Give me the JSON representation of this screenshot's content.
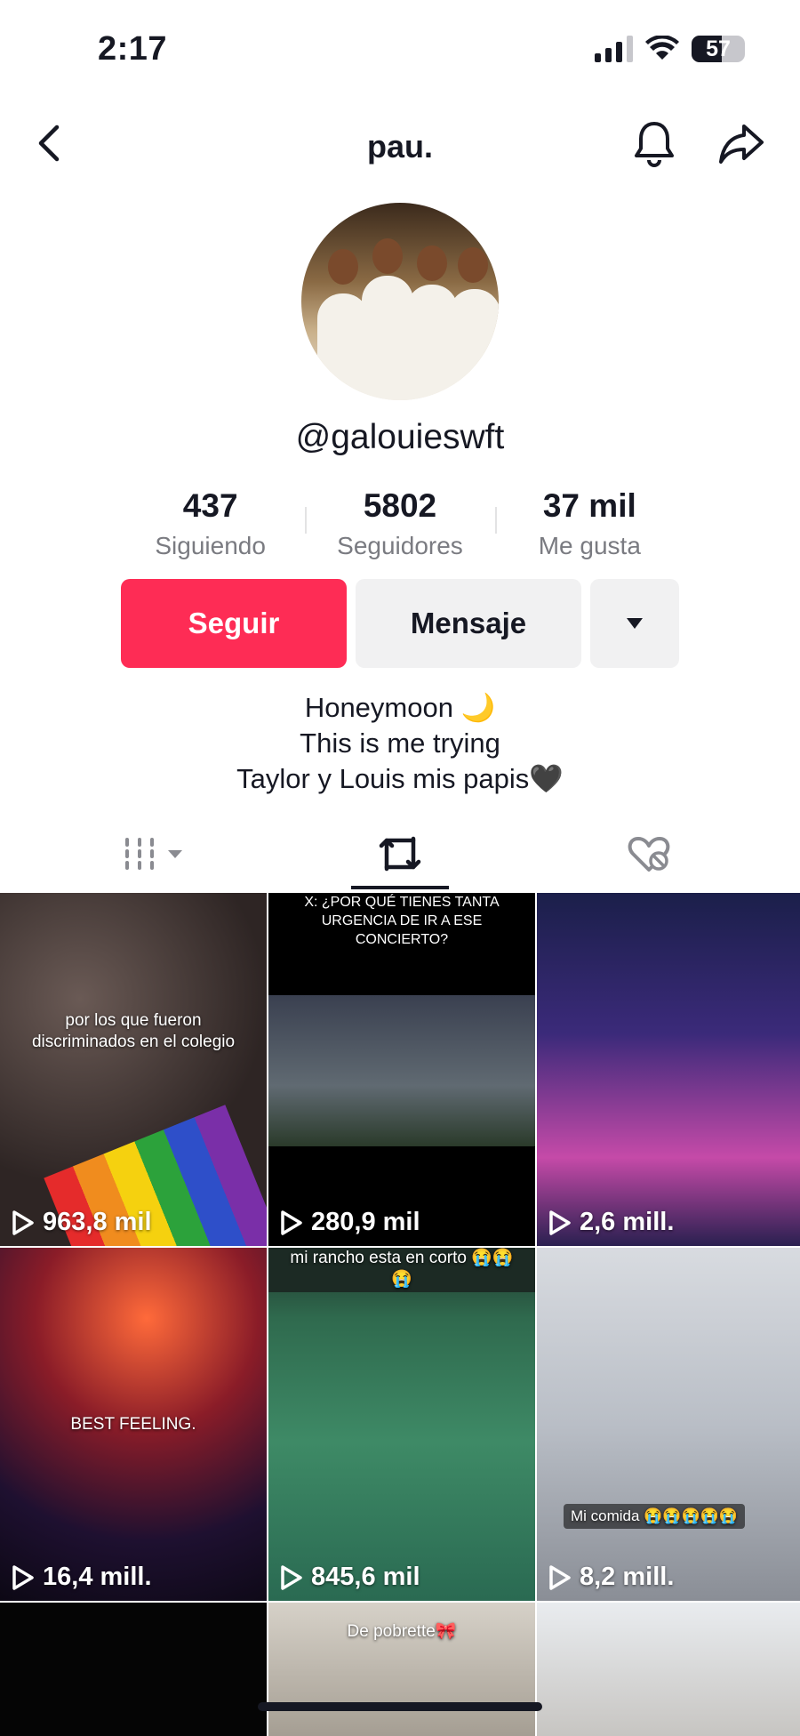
{
  "status_bar": {
    "time": "2:17",
    "battery": "57"
  },
  "nav": {
    "title": "pau."
  },
  "profile": {
    "handle": "@galouieswft"
  },
  "stats": [
    {
      "value": "437",
      "label": "Siguiendo"
    },
    {
      "value": "5802",
      "label": "Seguidores"
    },
    {
      "value": "37 mil",
      "label": "Me gusta"
    }
  ],
  "actions": {
    "follow": "Seguir",
    "message": "Mensaje"
  },
  "bio": {
    "line1": "Honeymoon 🌙",
    "line2": "This is me trying",
    "line3": "Taylor y Louis mis papis🖤"
  },
  "icons": {
    "back": "chevron-left-icon",
    "notifications": "bell-icon",
    "share": "share-icon",
    "videos_tab": "grid-icon",
    "reposts_tab": "repost-icon",
    "liked_tab": "hidden-heart-icon",
    "play": "play-icon"
  },
  "videos": [
    {
      "views": "963,8 mil",
      "caption": "por los que fueron discriminados en el colegio"
    },
    {
      "views": "280,9 mil",
      "caption": "X: ¿POR QUÉ TIENES TANTA URGENCIA DE IR A ESE CONCIERTO?"
    },
    {
      "views": "2,6 mill.",
      "caption": ""
    },
    {
      "views": "16,4 mill.",
      "caption": "BEST FEELING."
    },
    {
      "views": "845,6 mil",
      "caption": "mi rancho esta en corto 😭😭😭"
    },
    {
      "views": "8,2 mill.",
      "caption": "Mi comida 😭😭😭😭😭"
    },
    {
      "views": "",
      "caption": ""
    },
    {
      "views": "",
      "caption": "De pobrette🎀"
    },
    {
      "views": "",
      "caption": ""
    }
  ],
  "colors": {
    "accent": "#fe2c55",
    "text": "#161823",
    "muted": "#7a7b81",
    "button_bg": "#f1f1f2"
  }
}
